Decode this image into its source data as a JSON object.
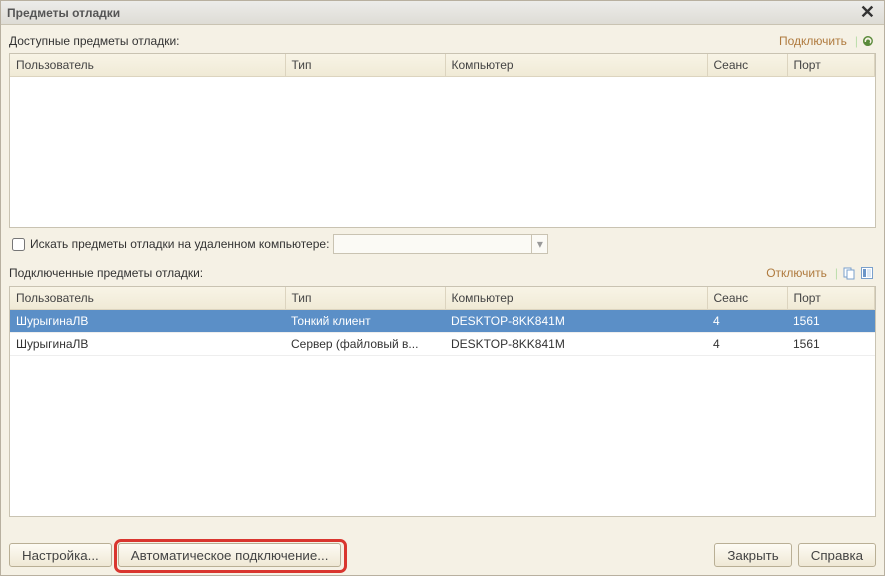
{
  "window": {
    "title": "Предметы отладки"
  },
  "available": {
    "label": "Доступные предметы отладки:",
    "connect_link": "Подключить",
    "columns": {
      "user": "Пользователь",
      "type": "Тип",
      "computer": "Компьютер",
      "session": "Сеанс",
      "port": "Порт"
    }
  },
  "remote": {
    "checkbox_label": "Искать предметы отладки на удаленном компьютере:",
    "checked": false,
    "value": ""
  },
  "connected": {
    "label": "Подключенные предметы отладки:",
    "disconnect_link": "Отключить",
    "columns": {
      "user": "Пользователь",
      "type": "Тип",
      "computer": "Компьютер",
      "session": "Сеанс",
      "port": "Порт"
    },
    "rows": [
      {
        "user": "ШурыгинаЛВ",
        "type": "Тонкий клиент",
        "computer": "DESKTOP-8KK841M",
        "session": "4",
        "port": "1561",
        "selected": true
      },
      {
        "user": "ШурыгинаЛВ",
        "type": "Сервер (файловый в...",
        "computer": "DESKTOP-8KK841M",
        "session": "4",
        "port": "1561",
        "selected": false
      }
    ]
  },
  "footer": {
    "settings": "Настройка...",
    "auto_connect": "Автоматическое подключение...",
    "close": "Закрыть",
    "help": "Справка"
  }
}
